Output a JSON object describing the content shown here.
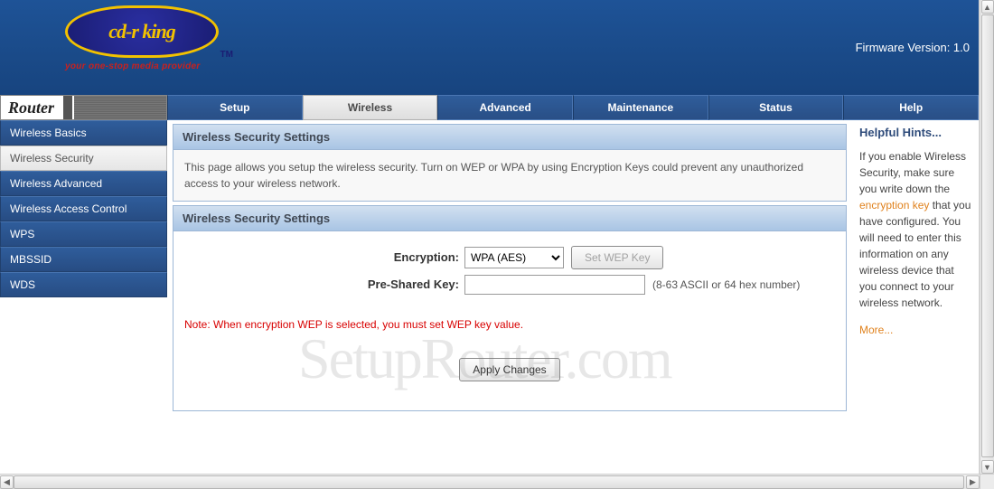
{
  "header": {
    "logo_text": "cd-r king",
    "logo_tm": "TM",
    "logo_tagline": "your one-stop media provider",
    "firmware_label": "Firmware Version: 1.0"
  },
  "nav": {
    "router_label": "Router",
    "tabs": [
      {
        "label": "Setup",
        "active": false
      },
      {
        "label": "Wireless",
        "active": true
      },
      {
        "label": "Advanced",
        "active": false
      },
      {
        "label": "Maintenance",
        "active": false
      },
      {
        "label": "Status",
        "active": false
      },
      {
        "label": "Help",
        "active": false
      }
    ]
  },
  "sidebar": {
    "items": [
      {
        "label": "Wireless Basics",
        "active": false
      },
      {
        "label": "Wireless Security",
        "active": true
      },
      {
        "label": "Wireless Advanced",
        "active": false
      },
      {
        "label": "Wireless Access Control",
        "active": false
      },
      {
        "label": "WPS",
        "active": false
      },
      {
        "label": "MBSSID",
        "active": false
      },
      {
        "label": "WDS",
        "active": false
      }
    ]
  },
  "main": {
    "panel1_title": "Wireless Security Settings",
    "panel1_desc": "This page allows you setup the wireless security. Turn on WEP or WPA by using Encryption Keys could prevent any unauthorized access to your wireless network.",
    "panel2_title": "Wireless Security Settings",
    "encryption_label": "Encryption:",
    "encryption_value": "WPA (AES)",
    "set_wep_btn": "Set WEP Key",
    "psk_label": "Pre-Shared Key:",
    "psk_value": "",
    "psk_hint": "(8-63 ASCII or 64 hex number)",
    "note": "Note: When encryption WEP is selected, you must set WEP key value.",
    "apply_btn": "Apply Changes"
  },
  "hints": {
    "header": "Helpful Hints...",
    "body_pre": "If you enable Wireless Security, make sure you write down the ",
    "key_link": "encryption key",
    "body_post": " that you have configured. You will need to enter this information on any wireless device that you connect to your wireless network.",
    "more": "More..."
  },
  "watermark": "SetupRouter.com"
}
